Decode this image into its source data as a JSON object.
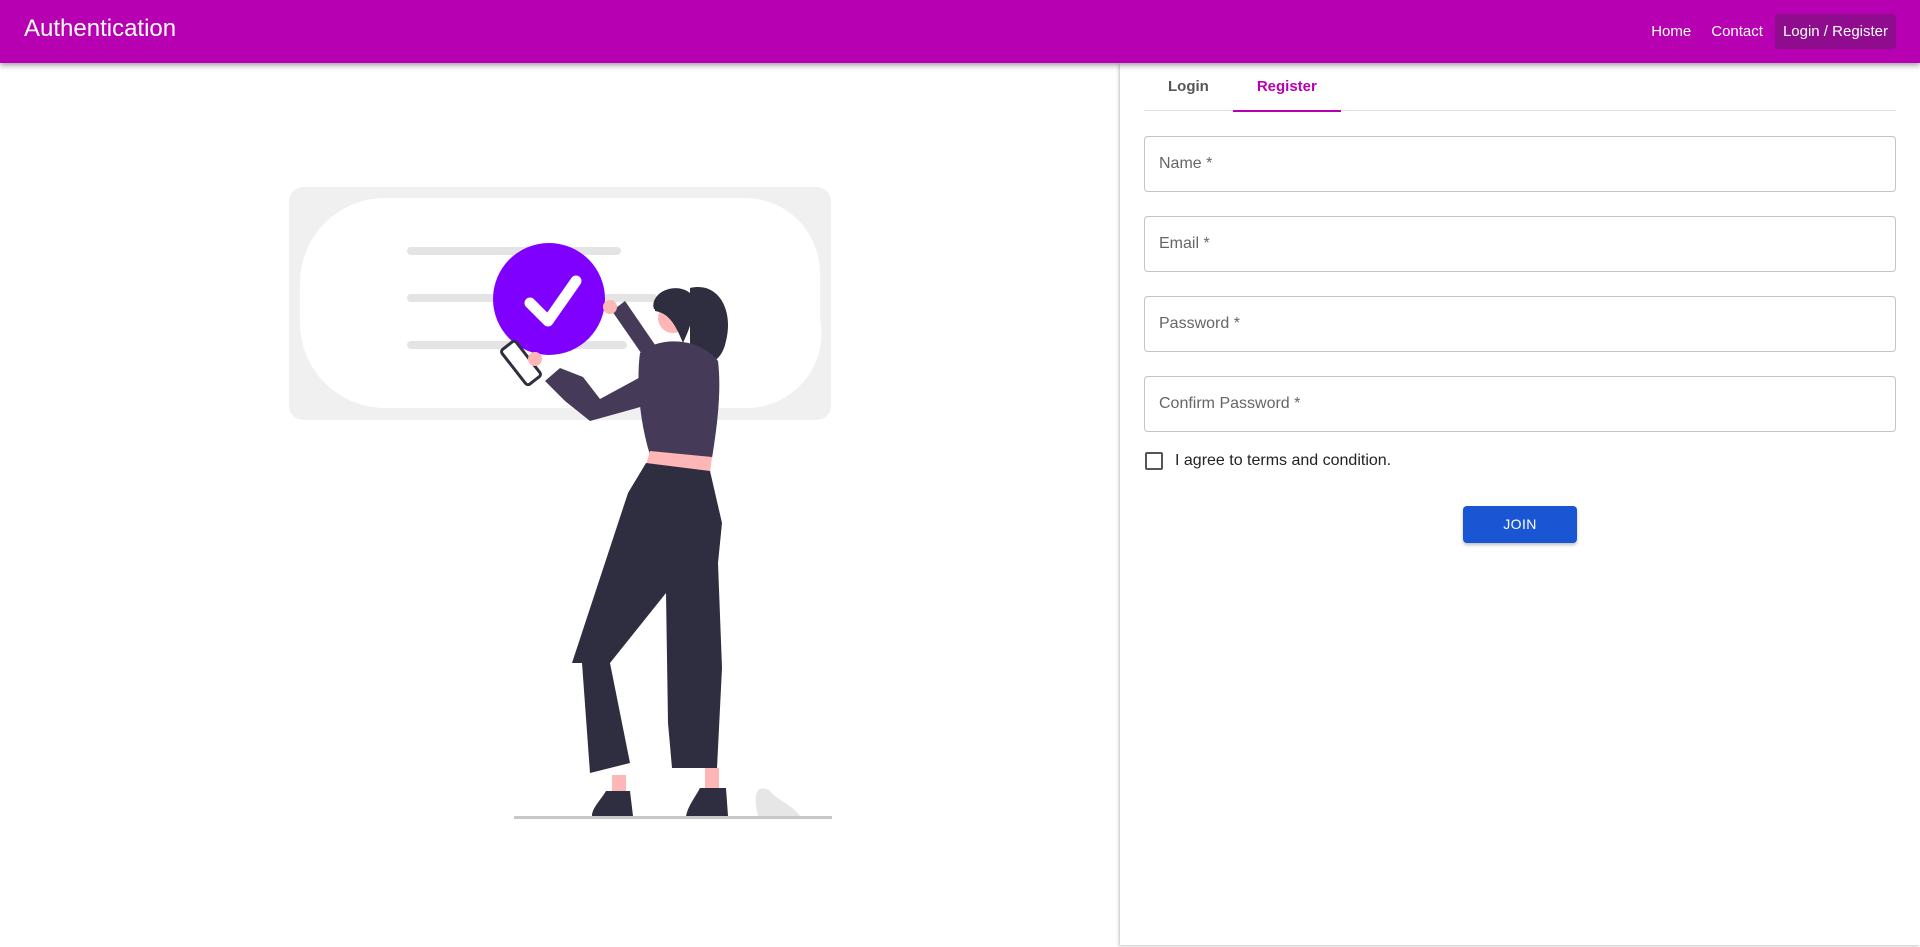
{
  "appbar": {
    "title": "Authentication",
    "nav": [
      {
        "label": "Home"
      },
      {
        "label": "Contact"
      },
      {
        "label": "Login / Register"
      }
    ]
  },
  "tabs": [
    {
      "label": "Login"
    },
    {
      "label": "Register"
    }
  ],
  "form": {
    "name_placeholder": "Name *",
    "email_placeholder": "Email *",
    "password_placeholder": "Password *",
    "confirm_password_placeholder": "Confirm Password *",
    "terms_label": "I agree to terms and condition.",
    "terms_checked": false,
    "join_label": "JOIN"
  },
  "illustration": {
    "icon": "check-circle-icon",
    "accent_color": "#8000ff"
  },
  "colors": {
    "brand": "#b800b3",
    "brand_dark": "#8e0c8d",
    "button": "#1a56d4"
  }
}
